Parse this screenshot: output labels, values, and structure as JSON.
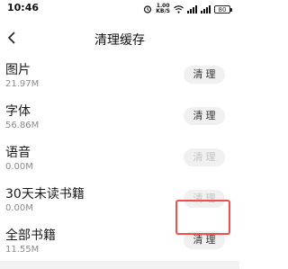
{
  "status_bar": {
    "time": "10:46",
    "net_speed_value": "1.00",
    "net_speed_unit": "KB/S",
    "battery": "80"
  },
  "header": {
    "title": "清理缓存"
  },
  "items": [
    {
      "title": "图片",
      "size": "21.97M",
      "button": "清理",
      "enabled": true
    },
    {
      "title": "字体",
      "size": "56.86M",
      "button": "清理",
      "enabled": true
    },
    {
      "title": "语音",
      "size": "0.00M",
      "button": "清理",
      "enabled": false
    },
    {
      "title": "30天未读书籍",
      "size": "0.00M",
      "button": "清理",
      "enabled": false
    },
    {
      "title": "全部书籍",
      "size": "11.55M",
      "button": "清理",
      "enabled": true
    }
  ],
  "colors": {
    "highlight": "#ef4f4f",
    "button_bg": "#f0f0f0",
    "disabled_text": "#c4c4c4"
  }
}
